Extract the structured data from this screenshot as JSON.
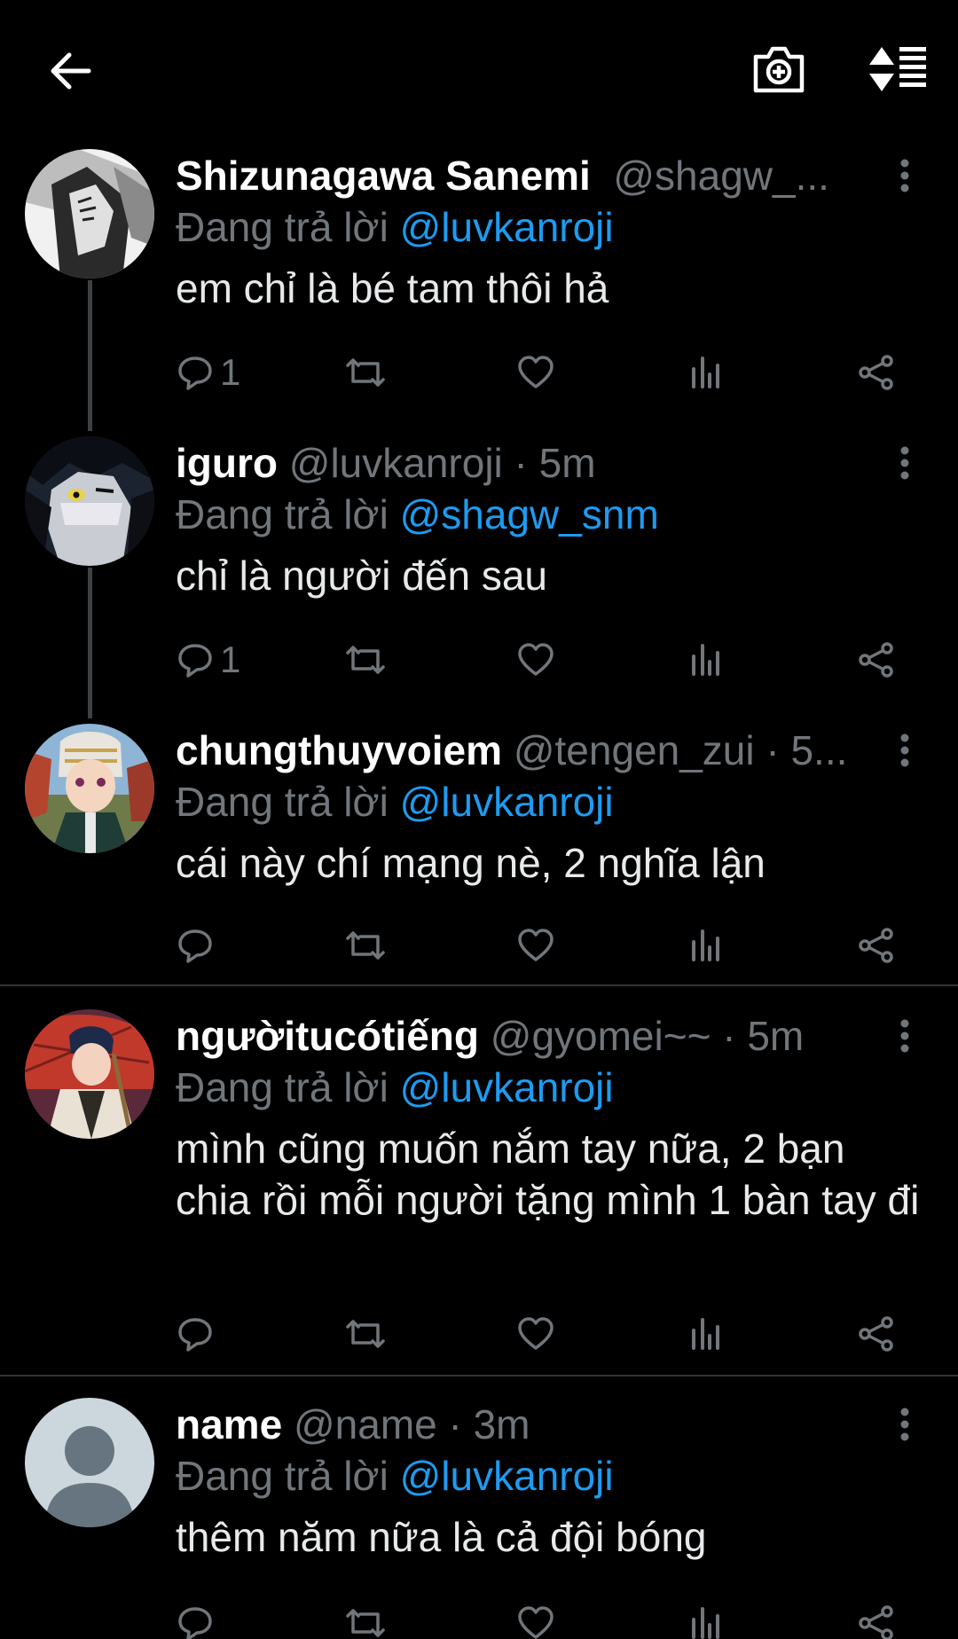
{
  "topbar": {
    "back_icon": "back-arrow-icon",
    "camera_icon": "camera-plus-icon",
    "sort_icon": "sort-icon"
  },
  "reply_prefix": "Đang trả lời",
  "tweets": [
    {
      "name": "Shizunagawa Sanemi",
      "handle_meta": "@shagw_...",
      "mention": "@luvkanroji",
      "text": "em chỉ là bé tam thôi hả",
      "reply_count": "1"
    },
    {
      "name": "iguro",
      "handle_meta": "@luvkanroji · 5m",
      "mention": "@shagw_snm",
      "text": "chỉ là người đến sau",
      "reply_count": "1"
    },
    {
      "name": "chungthuyvoiem",
      "handle_meta": "@tengen_zui · 5...",
      "mention": "@luvkanroji",
      "text": "cái này chí mạng nè, 2 nghĩa lận",
      "reply_count": ""
    },
    {
      "name": "ngườitucótiếng",
      "handle_meta": "@gyomei~~ · 5m",
      "mention": "@luvkanroji",
      "text": "mình cũng muốn nắm tay nữa, 2 bạn chia rồi mỗi người tặng mình 1 bàn tay đi",
      "reply_count": ""
    },
    {
      "name": "name",
      "handle_meta": "@name · 3m",
      "mention": "@luvkanroji",
      "text": "thêm năm nữa là cả đội bóng",
      "reply_count": ""
    }
  ],
  "colors": {
    "background": "#000000",
    "secondary_text": "#71767b",
    "mention": "#1d9bf0",
    "divider": "#2f3336"
  }
}
